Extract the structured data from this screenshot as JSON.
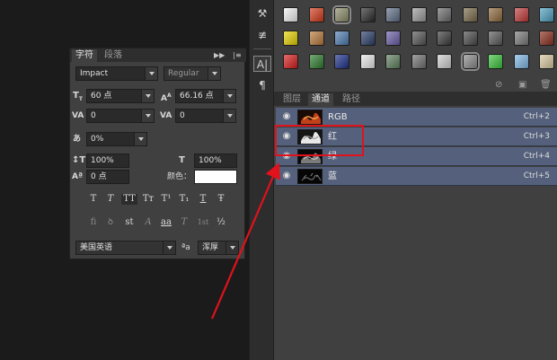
{
  "character_panel": {
    "tabs": [
      "字符",
      "段落"
    ],
    "font_family": "Impact",
    "font_style": "Regular",
    "font_size": "60 点",
    "leading": "66.16 点",
    "kerning": "0",
    "tracking": "0",
    "scale_pct": "0%",
    "vertical_scale": "100%",
    "horizontal_scale": "100%",
    "baseline_shift": "0 点",
    "color_label": "颜色：",
    "type_styles": [
      "T",
      "T",
      "TT",
      "Tт",
      "T¹",
      "T₁",
      "T",
      "Ŧ"
    ],
    "opentype_styles": [
      "fi",
      "ꝺ",
      "st",
      "A",
      "aa",
      "T",
      "1st",
      "½"
    ],
    "language": "美国英语",
    "aa_label": "ªa",
    "antialias": "浑厚"
  },
  "channels_panel": {
    "tabs": [
      "图层",
      "通道",
      "路径"
    ],
    "active_tab": 1,
    "rows": [
      {
        "name": "RGB",
        "shortcut": "Ctrl+2"
      },
      {
        "name": "红",
        "shortcut": "Ctrl+3"
      },
      {
        "name": "绿",
        "shortcut": "Ctrl+4"
      },
      {
        "name": "蓝",
        "shortcut": "Ctrl+5"
      }
    ]
  },
  "styles_panel": {
    "swatches": [
      [
        "#f2f2f2",
        "#d23a1a",
        "#8c8c6a",
        "#2b2b2b",
        "#5f6f86",
        "#9a9a9a",
        "#6b6b6b",
        "#7a6a4a",
        "#8f6a3c",
        "#c23b3b",
        "#4fa0c0"
      ],
      [
        "#e6d200",
        "#b97a3c",
        "#4f7db2",
        "#2a3f6b",
        "#6b5ea8",
        "#555555",
        "#3c3c3c",
        "#4a4a4a",
        "#5a5a5a",
        "#7a7a7a",
        "#8b2e1e"
      ],
      [
        "#d81d1d",
        "#2e7d2e",
        "#1d2f8a",
        "#e8e8e8",
        "#5f7f5f",
        "#707070",
        "#cfcfcf",
        "#8a8a8a",
        "#3cc43c",
        "#7fb8e6",
        "#d9c9a0"
      ]
    ]
  },
  "colors": {
    "highlight": "#e0121c",
    "selected_row": "#55617c",
    "panel_bg": "#404040"
  }
}
